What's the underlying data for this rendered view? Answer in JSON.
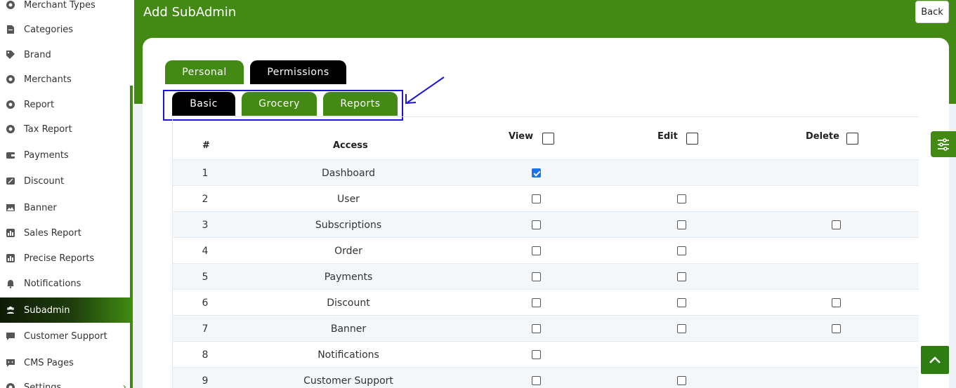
{
  "sidebar": {
    "items": [
      {
        "label": "Merchant Types",
        "icon": "gear-icon"
      },
      {
        "label": "Categories",
        "icon": "document-icon"
      },
      {
        "label": "Brand",
        "icon": "tag-icon"
      },
      {
        "label": "Merchants",
        "icon": "gear-icon"
      },
      {
        "label": "Report",
        "icon": "gear-icon"
      },
      {
        "label": "Tax Report",
        "icon": "gear-icon"
      },
      {
        "label": "Payments",
        "icon": "wallet-icon"
      },
      {
        "label": "Discount",
        "icon": "percent-icon"
      },
      {
        "label": "Banner",
        "icon": "image-icon"
      },
      {
        "label": "Sales Report",
        "icon": "chart-icon"
      },
      {
        "label": "Precise Reports",
        "icon": "chart-icon"
      },
      {
        "label": "Notifications",
        "icon": "bell-icon"
      },
      {
        "label": "Subadmin",
        "icon": "users-icon"
      },
      {
        "label": "Customer Support",
        "icon": "chat-icon"
      },
      {
        "label": "CMS Pages",
        "icon": "code-icon"
      },
      {
        "label": "Settings",
        "icon": "gear-icon"
      }
    ],
    "active": "Subadmin",
    "accent_color": "#438a14"
  },
  "header": {
    "title": "Add SubAdmin",
    "back_label": "Back"
  },
  "tabs": {
    "main": [
      {
        "label": "Personal",
        "active": false
      },
      {
        "label": "Permissions",
        "active": true
      }
    ],
    "sub": [
      {
        "label": "Basic",
        "active": true
      },
      {
        "label": "Grocery",
        "active": false
      },
      {
        "label": "Reports",
        "active": false
      }
    ]
  },
  "table": {
    "headers": {
      "num": "#",
      "access": "Access",
      "view": "View",
      "edit": "Edit",
      "delete": "Delete"
    },
    "rows": [
      {
        "num": "1",
        "access": "Dashboard",
        "view": true,
        "edit": null,
        "delete": null
      },
      {
        "num": "2",
        "access": "User",
        "view": false,
        "edit": false,
        "delete": null
      },
      {
        "num": "3",
        "access": "Subscriptions",
        "view": false,
        "edit": false,
        "delete": false
      },
      {
        "num": "4",
        "access": "Order",
        "view": false,
        "edit": false,
        "delete": null
      },
      {
        "num": "5",
        "access": "Payments",
        "view": false,
        "edit": false,
        "delete": null
      },
      {
        "num": "6",
        "access": "Discount",
        "view": false,
        "edit": false,
        "delete": false
      },
      {
        "num": "7",
        "access": "Banner",
        "view": false,
        "edit": false,
        "delete": false
      },
      {
        "num": "8",
        "access": "Notifications",
        "view": false,
        "edit": null,
        "delete": null
      },
      {
        "num": "9",
        "access": "Customer Support",
        "view": false,
        "edit": false,
        "delete": null
      }
    ]
  },
  "colors": {
    "brand_green": "#438a14",
    "annotation_blue": "#1c14d8",
    "active_tab": "#000000"
  }
}
